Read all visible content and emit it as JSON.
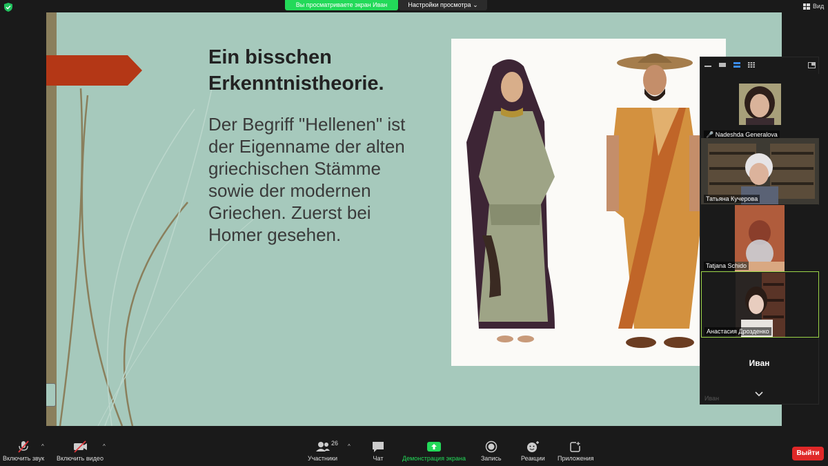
{
  "top_bar": {
    "share_banner": "Вы просматриваете экран Иван",
    "view_settings": "Настройки просмотра",
    "view_label": "Вид"
  },
  "slide": {
    "title": "Ein bisschen Erkenntnistheorie.",
    "body": "Der Begriff \"Hellenen\" ist der Eigenname der alten griechischen Stämme sowie der modernen Griechen. Zuerst bei Homer gesehen."
  },
  "gallery": {
    "participants": [
      {
        "name": "Nadeshda Generalova",
        "muted": true
      },
      {
        "name": "Татьяна Кучерова",
        "muted": false
      },
      {
        "name": "Tatjana Schido",
        "muted": false
      },
      {
        "name": "Анастасия Дрозденко",
        "muted": false,
        "active_speaker": true
      }
    ],
    "self_tile": {
      "name": "Иван",
      "sub": "Иван"
    }
  },
  "toolbar": {
    "audio": "Включить звук",
    "video": "Включить видео",
    "participants": "Участники",
    "participants_count": "26",
    "chat": "Чат",
    "share": "Демонстрация экрана",
    "record": "Запись",
    "reactions": "Реакции",
    "apps": "Приложения",
    "leave": "Выйти"
  },
  "colors": {
    "share_green": "#23d959",
    "leave_red": "#e02828",
    "slide_bg": "#a6c9bc",
    "active_border": "#9bd448"
  }
}
